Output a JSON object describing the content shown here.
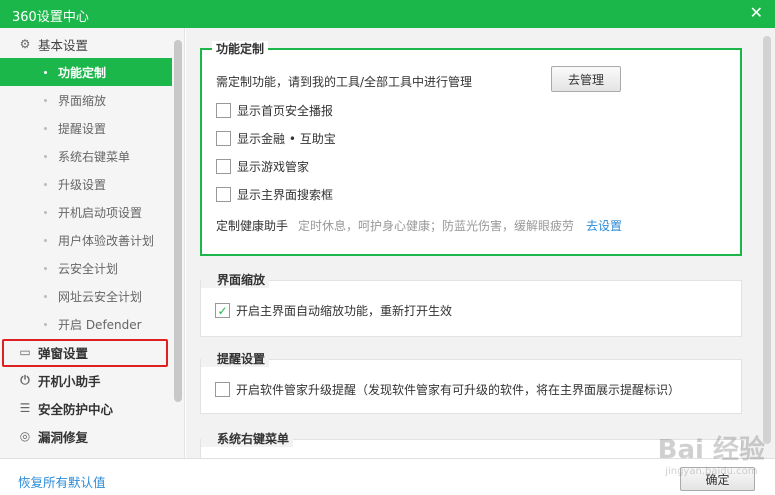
{
  "window": {
    "title": "360设置中心",
    "close_glyph": "✕"
  },
  "sidebar": {
    "categories": [
      {
        "label": "基本设置",
        "icon": "gear-icon",
        "glyph": "⚙"
      },
      {
        "label": "弹窗设置",
        "icon": "window-icon",
        "glyph": "▭"
      },
      {
        "label": "开机小助手",
        "icon": "power-icon",
        "glyph": "⏻"
      },
      {
        "label": "安全防护中心",
        "icon": "sliders-icon",
        "glyph": "☰"
      },
      {
        "label": "漏洞修复",
        "icon": "patch-icon",
        "glyph": "◎"
      }
    ],
    "items": [
      {
        "label": "功能定制"
      },
      {
        "label": "界面缩放"
      },
      {
        "label": "提醒设置"
      },
      {
        "label": "系统右键菜单"
      },
      {
        "label": "升级设置"
      },
      {
        "label": "开机启动项设置"
      },
      {
        "label": "用户体验改善计划"
      },
      {
        "label": "云安全计划"
      },
      {
        "label": "网址云安全计划"
      },
      {
        "label": "开启 Defender"
      }
    ]
  },
  "sections": {
    "feature": {
      "legend": "功能定制",
      "hint": "需定制功能，请到我的工具/全部工具中进行管理",
      "manage_button": "去管理",
      "options": [
        {
          "label": "显示首页安全播报",
          "checked": false
        },
        {
          "label": "显示金融 • 互助宝",
          "checked": false
        },
        {
          "label": "显示游戏管家",
          "checked": false
        },
        {
          "label": "显示主界面搜索框",
          "checked": false
        }
      ],
      "health_label": "定制健康助手",
      "health_desc": "定时休息，呵护身心健康；防蓝光伤害，缓解眼疲劳",
      "health_link": "去设置"
    },
    "zoom": {
      "legend": "界面缩放",
      "option": {
        "label": "开启主界面自动缩放功能，重新打开生效",
        "checked": true
      }
    },
    "remind": {
      "legend": "提醒设置",
      "option": {
        "label": "开启软件管家升级提醒（发现软件管家有可升级的软件，将在主界面展示提醒标识）",
        "checked": false
      }
    },
    "context_menu": {
      "legend": "系统右键菜单"
    }
  },
  "footer": {
    "restore_label": "恢复所有默认值",
    "ok_label": "确定"
  },
  "watermark": {
    "brand": "Bai 经验",
    "url": "jingyan.baidu.com"
  },
  "colors": {
    "accent": "#1cb74a",
    "link": "#2a8bd8",
    "highlight": "#e02020"
  }
}
